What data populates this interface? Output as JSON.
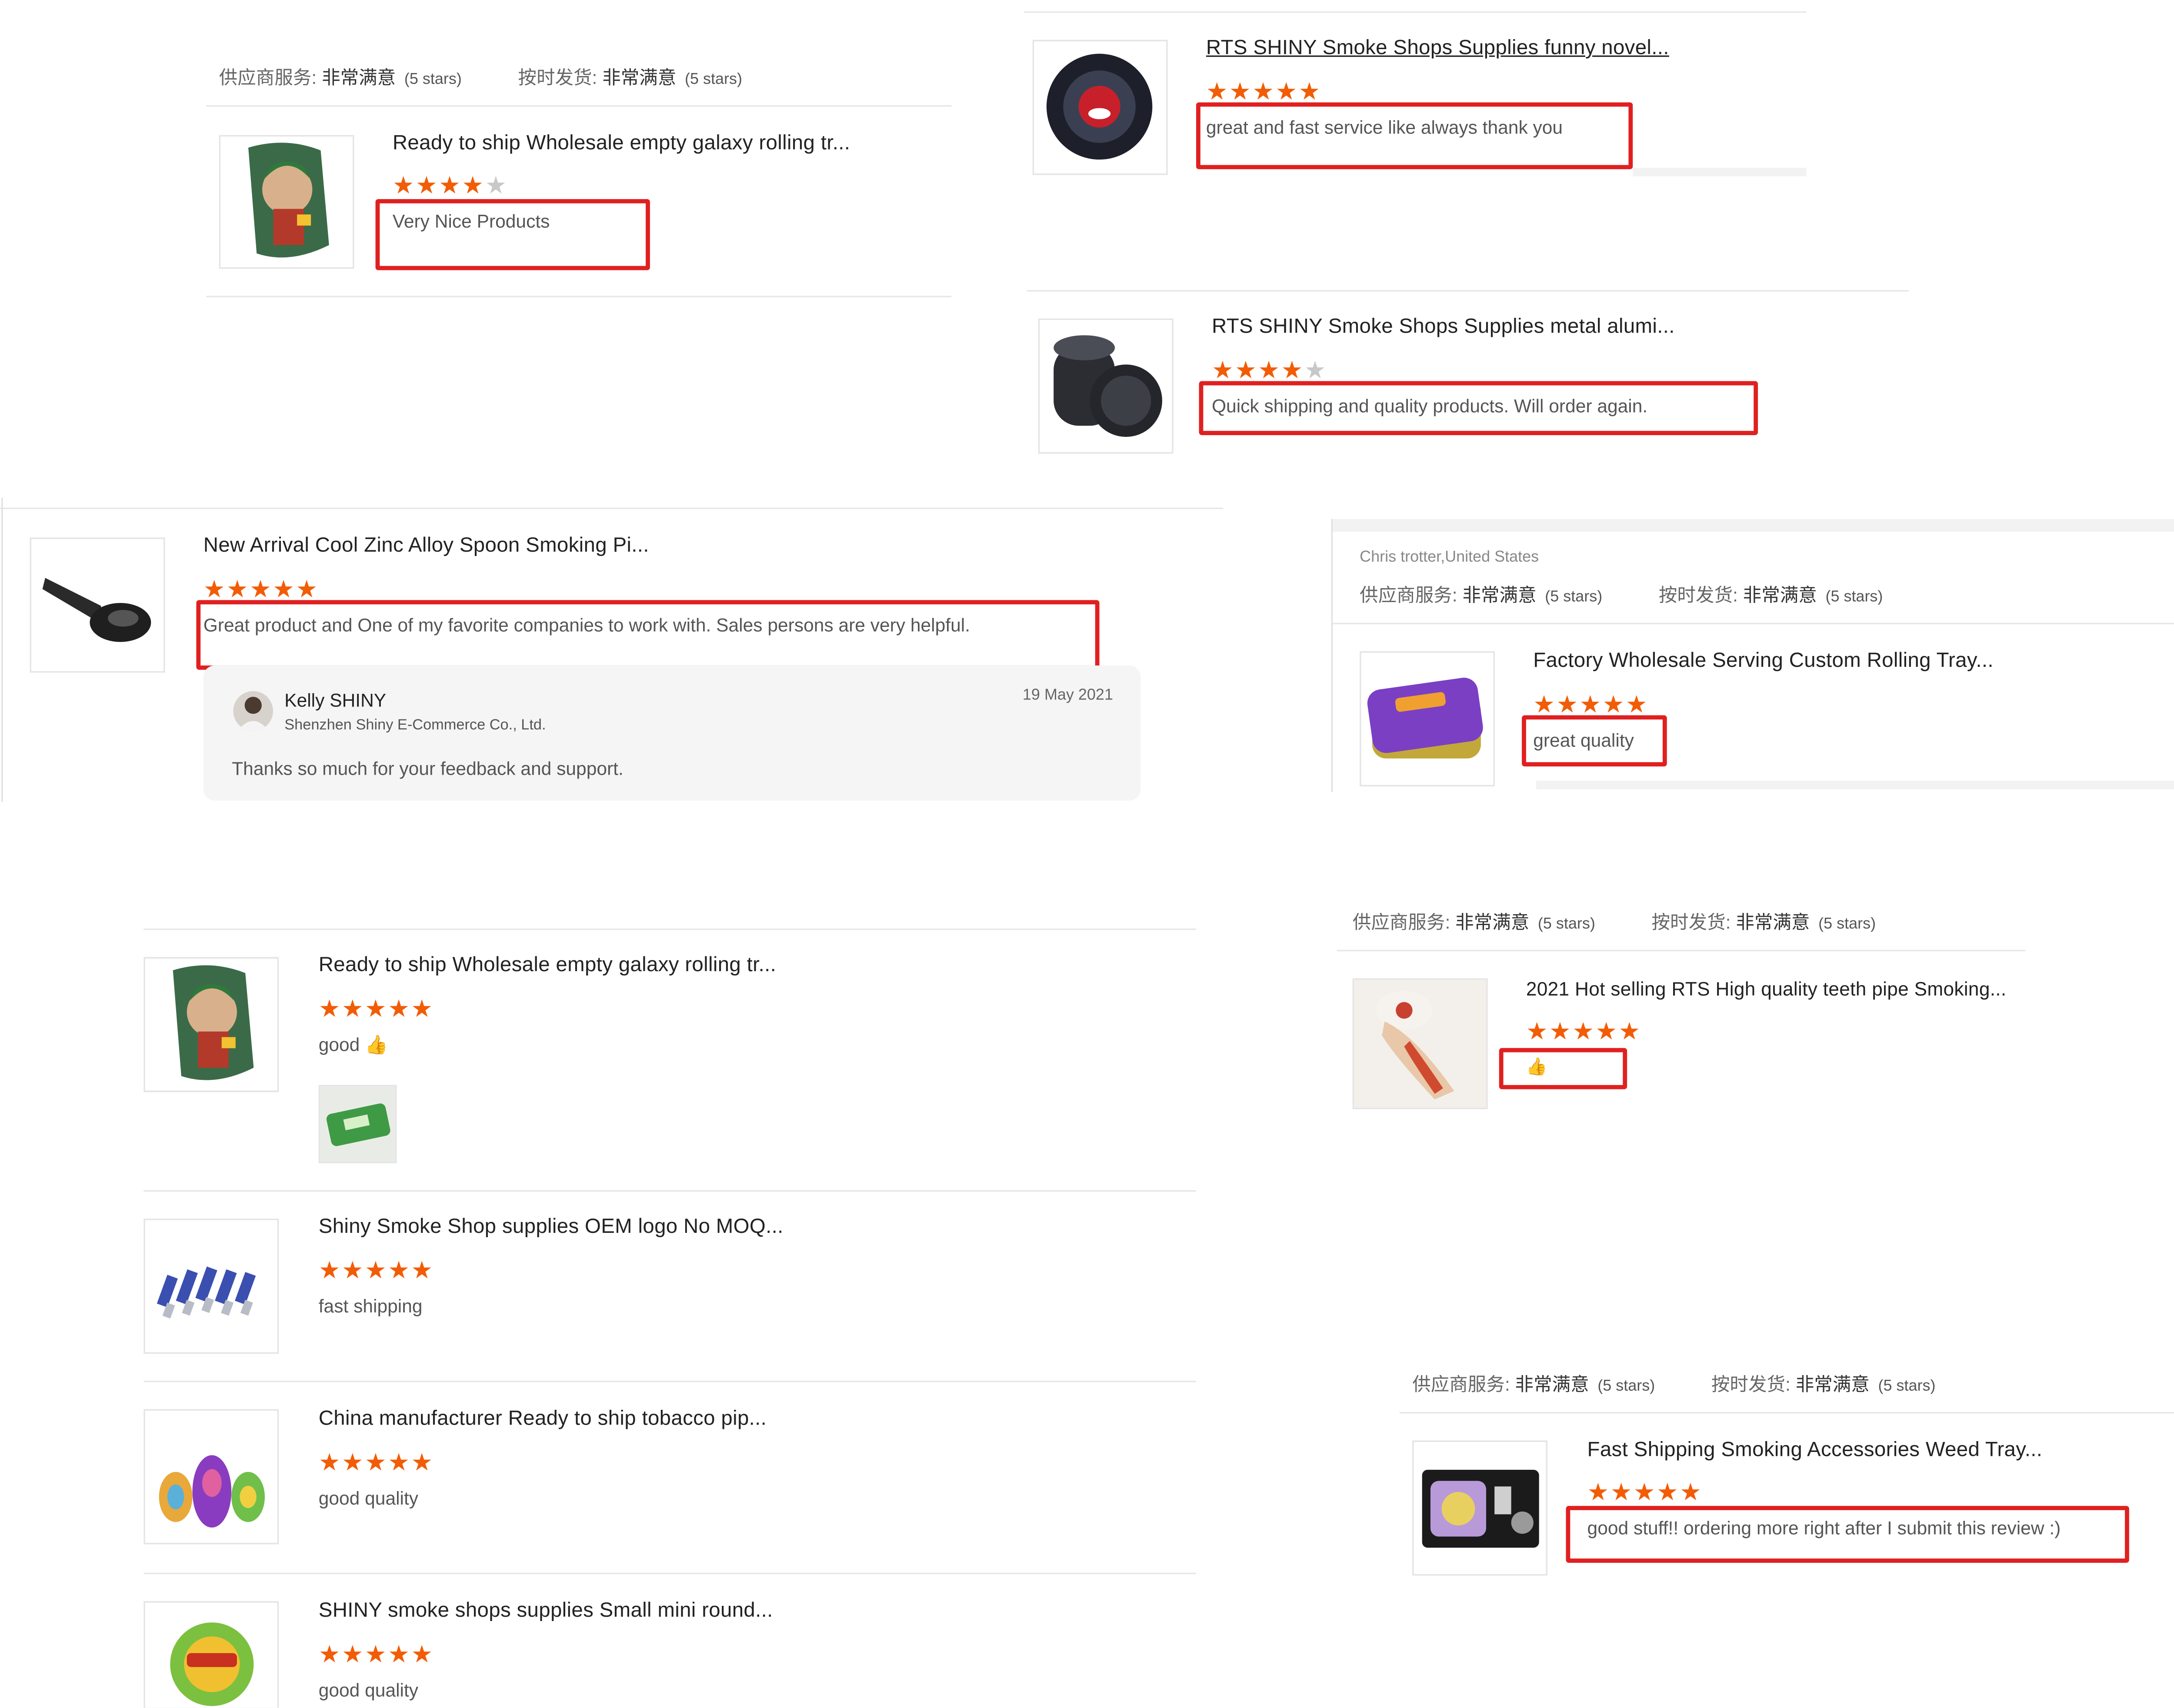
{
  "meta": {
    "supplier_service_label": "供应商服务:",
    "delivery_label": "按时发货:",
    "rating_text": "非常满意",
    "rating_stars": "(5 stars)"
  },
  "colors": {
    "star": "#f25c05",
    "highlight_box": "#e02020",
    "star_empty": "#c8c8c8"
  },
  "reviews": [
    {
      "title": "Ready to ship Wholesale empty galaxy rolling tr...",
      "stars": 4,
      "comment": "Very Nice Products",
      "thumb_icon": "rolling-tray-joker-image"
    },
    {
      "title": "RTS SHINY Smoke Shops Supplies funny novel...",
      "stars": 5,
      "comment": "great and fast service like always thank you",
      "thumb_icon": "ashtray-image"
    },
    {
      "title": "RTS SHINY Smoke Shops Supplies metal alumi...",
      "stars": 4,
      "comment": "Quick shipping and quality products. Will order again.",
      "thumb_icon": "grinder-image"
    },
    {
      "title": "New Arrival Cool Zinc Alloy Spoon Smoking Pi...",
      "stars": 5,
      "comment": "Great product and One of my favorite companies to work with. Sales persons are very helpful.",
      "thumb_icon": "spoon-pipe-image",
      "reply": {
        "name": "Kelly SHINY",
        "company": "Shenzhen Shiny E-Commerce Co., Ltd.",
        "date": "19 May 2021",
        "text": "Thanks so much for your feedback and support."
      }
    },
    {
      "reviewer": "Chris trotter,United States",
      "title": "Factory Wholesale Serving Custom Rolling Tray...",
      "stars": 5,
      "comment": "great quality",
      "thumb_icon": "purple-tray-image"
    },
    {
      "title": "Ready to ship Wholesale empty galaxy rolling tr...",
      "stars": 5,
      "comment": "good 👍",
      "thumb_icon": "rolling-tray-joker-image",
      "attachment_icon": "green-tray-photo"
    },
    {
      "title": "2021 Hot selling RTS High quality teeth pipe Smoking...",
      "stars": 5,
      "comment": "👍",
      "thumb_icon": "teeth-pipe-image"
    },
    {
      "title": "Shiny Smoke Shop supplies OEM logo No MOQ...",
      "stars": 5,
      "comment": "fast shipping",
      "thumb_icon": "metal-pipes-image"
    },
    {
      "title": "China manufacturer Ready to ship tobacco pip...",
      "stars": 5,
      "comment": "good quality",
      "thumb_icon": "silicone-pipes-image"
    },
    {
      "title": "Fast Shipping Smoking Accessories Weed Tray...",
      "stars": 5,
      "comment": "good stuff!! ordering more right after I submit this review :)",
      "thumb_icon": "tray-kit-image"
    },
    {
      "title": "SHINY smoke shops supplies Small mini round...",
      "stars": 5,
      "comment": "good quality",
      "thumb_icon": "round-ashtray-image"
    }
  ]
}
